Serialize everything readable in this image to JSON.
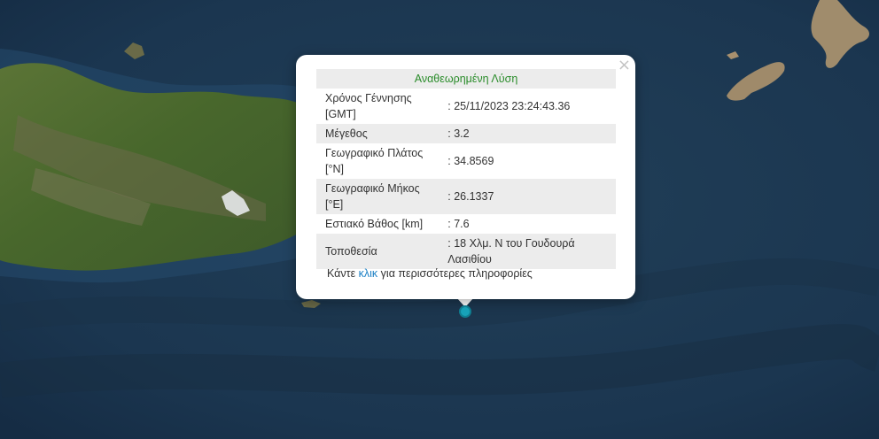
{
  "popup": {
    "header": "Αναθεωρημένη Λύση",
    "close_symbol": "×",
    "rows": [
      {
        "label": "Χρόνος Γέννησης [GMT]",
        "value": ": 25/11/2023 23:24:43.36"
      },
      {
        "label": "Μέγεθος",
        "value": ": 3.2"
      },
      {
        "label": "Γεωγραφικό Πλάτος [°N]",
        "value": ": 34.8569"
      },
      {
        "label": "Γεωγραφικό Μήκος [°E]",
        "value": ": 26.1337"
      },
      {
        "label": "Εστιακό Βάθος [km]",
        "value": ": 7.6"
      },
      {
        "label": "Τοποθεσία",
        "value": ": 18 Χλμ. Ν του Γουδουρά Λασιθίου"
      }
    ],
    "more_prefix": "Κάντε ",
    "more_link": "κλικ",
    "more_suffix": " για περισσότερες πληροφορίες"
  },
  "map": {
    "marker_icon": "epicenter-marker-icon",
    "colors": {
      "sea": "#1e3b55",
      "land": "#4d6a30",
      "marker": "#17a2b8"
    }
  }
}
